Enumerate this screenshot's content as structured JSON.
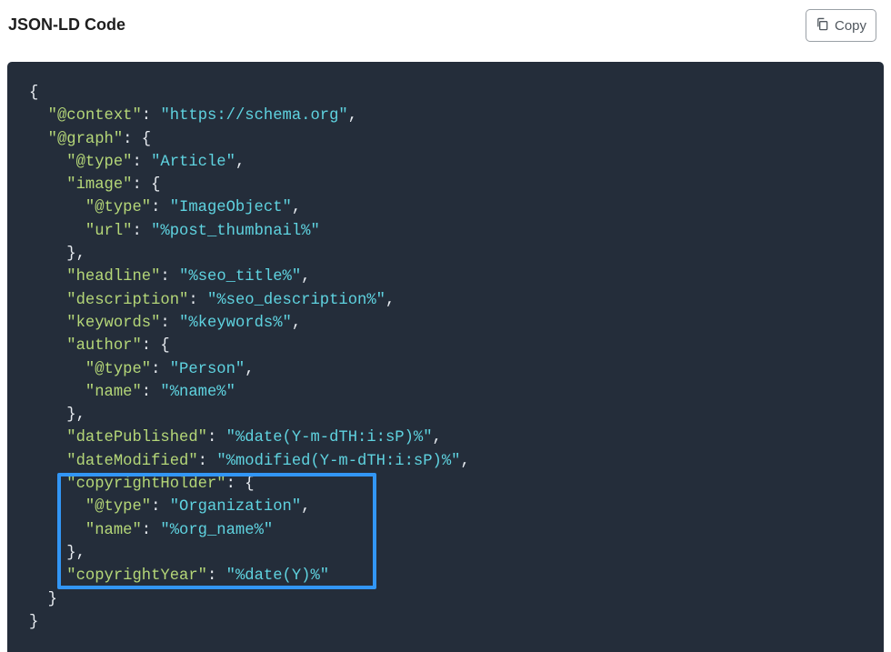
{
  "header": {
    "title": "JSON-LD Code",
    "copy_label": "Copy"
  },
  "icons": {
    "copy": "copy-icon"
  },
  "colors": {
    "code_background": "#242d3a",
    "key": "#b5d778",
    "string": "#5fd3e0",
    "punctuation": "#e7ebf0",
    "highlight": "#3296f5"
  },
  "code_lines": [
    [
      [
        "p",
        "{"
      ]
    ],
    [
      [
        "p",
        "  "
      ],
      [
        "k",
        "\"@context\""
      ],
      [
        "p",
        ": "
      ],
      [
        "s",
        "\"https://schema.org\""
      ],
      [
        "p",
        ","
      ]
    ],
    [
      [
        "p",
        "  "
      ],
      [
        "k",
        "\"@graph\""
      ],
      [
        "p",
        ": {"
      ]
    ],
    [
      [
        "p",
        "    "
      ],
      [
        "k",
        "\"@type\""
      ],
      [
        "p",
        ": "
      ],
      [
        "s",
        "\"Article\""
      ],
      [
        "p",
        ","
      ]
    ],
    [
      [
        "p",
        "    "
      ],
      [
        "k",
        "\"image\""
      ],
      [
        "p",
        ": {"
      ]
    ],
    [
      [
        "p",
        "      "
      ],
      [
        "k",
        "\"@type\""
      ],
      [
        "p",
        ": "
      ],
      [
        "s",
        "\"ImageObject\""
      ],
      [
        "p",
        ","
      ]
    ],
    [
      [
        "p",
        "      "
      ],
      [
        "k",
        "\"url\""
      ],
      [
        "p",
        ": "
      ],
      [
        "s",
        "\"%post_thumbnail%\""
      ]
    ],
    [
      [
        "p",
        "    },"
      ]
    ],
    [
      [
        "p",
        "    "
      ],
      [
        "k",
        "\"headline\""
      ],
      [
        "p",
        ": "
      ],
      [
        "s",
        "\"%seo_title%\""
      ],
      [
        "p",
        ","
      ]
    ],
    [
      [
        "p",
        "    "
      ],
      [
        "k",
        "\"description\""
      ],
      [
        "p",
        ": "
      ],
      [
        "s",
        "\"%seo_description%\""
      ],
      [
        "p",
        ","
      ]
    ],
    [
      [
        "p",
        "    "
      ],
      [
        "k",
        "\"keywords\""
      ],
      [
        "p",
        ": "
      ],
      [
        "s",
        "\"%keywords%\""
      ],
      [
        "p",
        ","
      ]
    ],
    [
      [
        "p",
        "    "
      ],
      [
        "k",
        "\"author\""
      ],
      [
        "p",
        ": {"
      ]
    ],
    [
      [
        "p",
        "      "
      ],
      [
        "k",
        "\"@type\""
      ],
      [
        "p",
        ": "
      ],
      [
        "s",
        "\"Person\""
      ],
      [
        "p",
        ","
      ]
    ],
    [
      [
        "p",
        "      "
      ],
      [
        "k",
        "\"name\""
      ],
      [
        "p",
        ": "
      ],
      [
        "s",
        "\"%name%\""
      ]
    ],
    [
      [
        "p",
        "    },"
      ]
    ],
    [
      [
        "p",
        "    "
      ],
      [
        "k",
        "\"datePublished\""
      ],
      [
        "p",
        ": "
      ],
      [
        "s",
        "\"%date(Y-m-dTH:i:sP)%\""
      ],
      [
        "p",
        ","
      ]
    ],
    [
      [
        "p",
        "    "
      ],
      [
        "k",
        "\"dateModified\""
      ],
      [
        "p",
        ": "
      ],
      [
        "s",
        "\"%modified(Y-m-dTH:i:sP)%\""
      ],
      [
        "p",
        ","
      ]
    ],
    [
      [
        "p",
        "    "
      ],
      [
        "k",
        "\"copyrightHolder\""
      ],
      [
        "p",
        ": {"
      ]
    ],
    [
      [
        "p",
        "      "
      ],
      [
        "k",
        "\"@type\""
      ],
      [
        "p",
        ": "
      ],
      [
        "s",
        "\"Organization\""
      ],
      [
        "p",
        ","
      ]
    ],
    [
      [
        "p",
        "      "
      ],
      [
        "k",
        "\"name\""
      ],
      [
        "p",
        ": "
      ],
      [
        "s",
        "\"%org_name%\""
      ]
    ],
    [
      [
        "p",
        "    },"
      ]
    ],
    [
      [
        "p",
        "    "
      ],
      [
        "k",
        "\"copyrightYear\""
      ],
      [
        "p",
        ": "
      ],
      [
        "s",
        "\"%date(Y)%\""
      ]
    ],
    [
      [
        "p",
        "  }"
      ]
    ],
    [
      [
        "p",
        "}"
      ]
    ]
  ]
}
